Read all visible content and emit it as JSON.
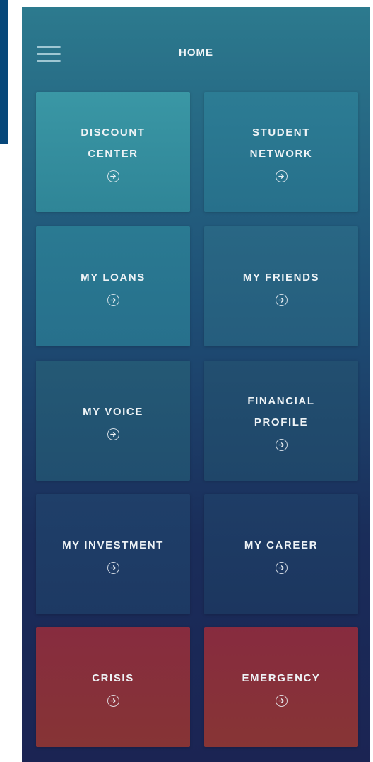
{
  "header": {
    "title": "HOME",
    "menu_icon": "hamburger-menu-icon"
  },
  "tiles": [
    {
      "label": "DISCOUNT\nCENTER",
      "icon": "arrow-circle-right-icon"
    },
    {
      "label": "STUDENT\nNETWORK",
      "icon": "arrow-circle-right-icon"
    },
    {
      "label": "MY LOANS",
      "icon": "arrow-circle-right-icon"
    },
    {
      "label": "MY FRIENDS",
      "icon": "arrow-circle-right-icon"
    },
    {
      "label": "MY VOICE",
      "icon": "arrow-circle-right-icon"
    },
    {
      "label": "FINANCIAL\nPROFILE",
      "icon": "arrow-circle-right-icon"
    },
    {
      "label": "MY INVESTMENT",
      "icon": "arrow-circle-right-icon"
    },
    {
      "label": "MY CAREER",
      "icon": "arrow-circle-right-icon"
    },
    {
      "label": "CRISIS",
      "icon": "arrow-circle-right-icon"
    },
    {
      "label": "EMERGENCY",
      "icon": "arrow-circle-right-icon"
    }
  ],
  "colors": {
    "accent_teal": "#2f8597",
    "navy": "#1b2453",
    "alert_red": "#863435",
    "text": "#eef3f6"
  }
}
